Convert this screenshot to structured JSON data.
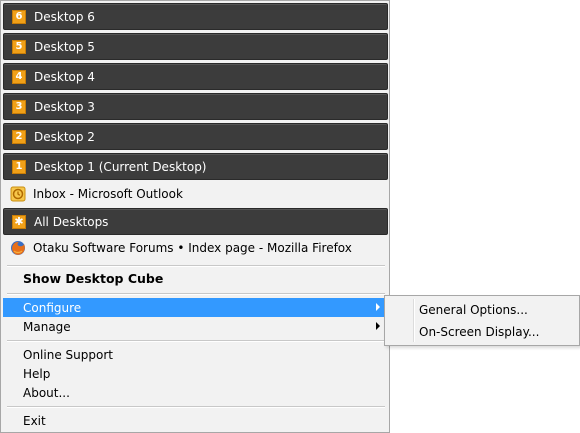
{
  "desktops": [
    {
      "number": "6",
      "label": "Desktop 6"
    },
    {
      "number": "5",
      "label": "Desktop 5"
    },
    {
      "number": "4",
      "label": "Desktop 4"
    },
    {
      "number": "3",
      "label": "Desktop 3"
    },
    {
      "number": "2",
      "label": "Desktop 2"
    },
    {
      "number": "1",
      "label": "Desktop 1 (Current Desktop)"
    }
  ],
  "windows": {
    "outlook": {
      "label": "Inbox - Microsoft Outlook",
      "icon": "outlook-icon"
    },
    "firefox": {
      "label": "Otaku Software Forums • Index page - Mozilla Firefox",
      "icon": "firefox-icon"
    }
  },
  "all_desktops": {
    "label": "All Desktops",
    "icon": "star-icon"
  },
  "menu": {
    "show_cube": "Show Desktop Cube",
    "configure": "Configure",
    "manage": "Manage",
    "online_support": "Online Support",
    "help": "Help",
    "about": "About...",
    "exit": "Exit"
  },
  "submenu": {
    "general_options": "General Options...",
    "osd": "On-Screen Display..."
  },
  "colors": {
    "desktop_bg": "#3c3c3c",
    "badge": "#f0a018",
    "highlight": "#3399ff"
  }
}
